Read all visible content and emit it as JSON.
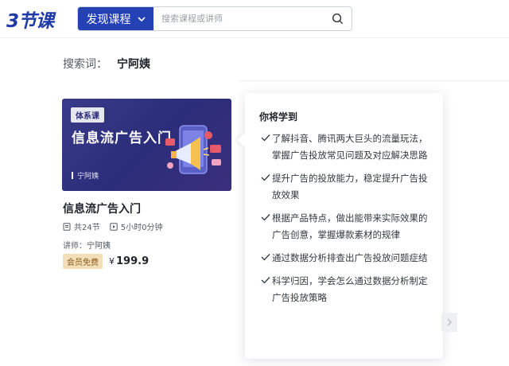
{
  "header": {
    "logo_text": "3节课",
    "discover_label": "发现课程",
    "search_placeholder": "搜索课程或讲师"
  },
  "search_result": {
    "label": "搜索词：",
    "keyword": "宁阿姨"
  },
  "course": {
    "thumbnail": {
      "badge": "体系课",
      "title": "信息流广告入门",
      "teacher": "宁阿姨"
    },
    "title": "信息流广告入门",
    "sections": "共24节",
    "duration": "5小时0分钟",
    "teacher": "讲师：宁阿姨",
    "member_badge": "会员免费",
    "price_symbol": "¥",
    "price": "199.9"
  },
  "popover": {
    "title": "你将学到",
    "items": [
      "了解抖音、腾讯两大巨头的流量玩法，掌握广告投放常见问题及对应解决思路",
      "提升广告的投放能力，稳定提升广告投放效果",
      "根据产品特点，做出能带来实际效果的广告创意，掌握爆款素材的规律",
      "通过数据分析排查出广告投放问题症结",
      "科学归因，学会怎么通过数据分析制定广告投放策略"
    ]
  },
  "colors": {
    "brand": "#2542b5",
    "thumbnail_bg": "#2b2d7a",
    "member_badge_bg": "#f2dfb7"
  }
}
